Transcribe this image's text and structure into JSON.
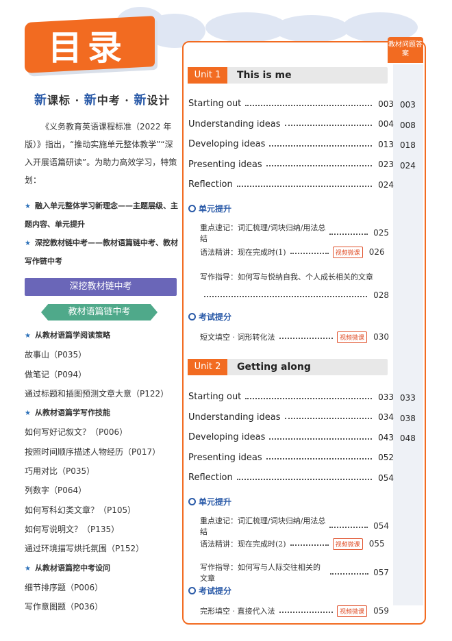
{
  "header": {
    "title": "目录"
  },
  "left": {
    "slogan": {
      "xin1": "新",
      "p1": "课标 · ",
      "xin2": "新",
      "p2": "中考 · ",
      "xin3": "新",
      "p3": "设计"
    },
    "intro": "《义务教育英语课程标准（2022 年版）》指出，“推动实施单元整体教学”“深入开展语篇研读”。为助力高效学习，特策划：",
    "bullets": [
      "融入单元整体学习新理念——主题层级、主题内容、单元提升",
      "深挖教材链中考——教材语篇链中考、教材写作链中考"
    ],
    "purple_bar": "深挖教材链中考",
    "green_tag": "教材语篇链中考",
    "list": [
      {
        "text": "从教材语篇学阅读策略",
        "section": true
      },
      {
        "text": "故事山（P035）",
        "section": false
      },
      {
        "text": "做笔记（P094）",
        "section": false
      },
      {
        "text": "通过标题和插图预测文章大意（P122）",
        "section": false
      },
      {
        "text": "从教材语篇学写作技能",
        "section": true
      },
      {
        "text": "如何写好记叙文？（P006）",
        "section": false
      },
      {
        "text": "按照时间顺序描述人物经历（P017）",
        "section": false
      },
      {
        "text": "巧用对比（P035）",
        "section": false
      },
      {
        "text": "列数字（P064）",
        "section": false
      },
      {
        "text": "如何写科幻类文章？（P105）",
        "section": false
      },
      {
        "text": "如何写说明文？（P135）",
        "section": false
      },
      {
        "text": "通过环境描写烘托氛围（P152）",
        "section": false
      },
      {
        "text": "从教材语篇挖中考设问",
        "section": true
      },
      {
        "text": "细节排序题（P006）",
        "section": false
      },
      {
        "text": "写作意图题（P036）",
        "section": false
      }
    ]
  },
  "right": {
    "answer_tag": "教材问题答案",
    "units": [
      {
        "label": "Unit 1",
        "title": "This is me",
        "entries": [
          {
            "name": "Starting out",
            "page": "003",
            "answer": "003"
          },
          {
            "name": "Understanding ideas",
            "page": "004",
            "answer": "008"
          },
          {
            "name": "Developing ideas",
            "page": "013",
            "answer": "018"
          },
          {
            "name": "Presenting ideas",
            "page": "023",
            "answer": "024"
          },
          {
            "name": "Reflection",
            "page": "024",
            "answer": ""
          }
        ],
        "section1": "单元提升",
        "sub_entries": [
          {
            "text": "重点速记：词汇梳理/词块归纳/用法总结",
            "page": "025",
            "video": ""
          },
          {
            "text": "语法精讲：现在完成时(1)",
            "page": "026",
            "video": "视频微课"
          },
          {
            "text": "写作指导：如何写与悦纳自我、个人成长相关的文章",
            "page": "028",
            "video": ""
          }
        ],
        "section2": "考试提分",
        "exam_entry": {
          "text": "短文填空 · 词形转化法",
          "page": "030",
          "video": "视频微课"
        }
      },
      {
        "label": "Unit 2",
        "title": "Getting along",
        "entries": [
          {
            "name": "Starting out",
            "page": "033",
            "answer": "033"
          },
          {
            "name": "Understanding ideas",
            "page": "034",
            "answer": "038"
          },
          {
            "name": "Developing ideas",
            "page": "043",
            "answer": "048"
          },
          {
            "name": "Presenting ideas",
            "page": "052",
            "answer": ""
          },
          {
            "name": "Reflection",
            "page": "054",
            "answer": ""
          }
        ],
        "section1": "单元提升",
        "sub_entries": [
          {
            "text": "重点速记：词汇梳理/词块归纳/用法总结",
            "page": "054",
            "video": ""
          },
          {
            "text": "语法精讲：现在完成时(2)",
            "page": "055",
            "video": "视频微课"
          },
          {
            "text": "写作指导：如何写与人际交往相关的文章",
            "page": "057",
            "video": ""
          }
        ],
        "section2": "考试提分",
        "exam_entry": {
          "text": "完形填空 · 直接代入法",
          "page": "059",
          "video": "视频微课"
        }
      }
    ]
  }
}
